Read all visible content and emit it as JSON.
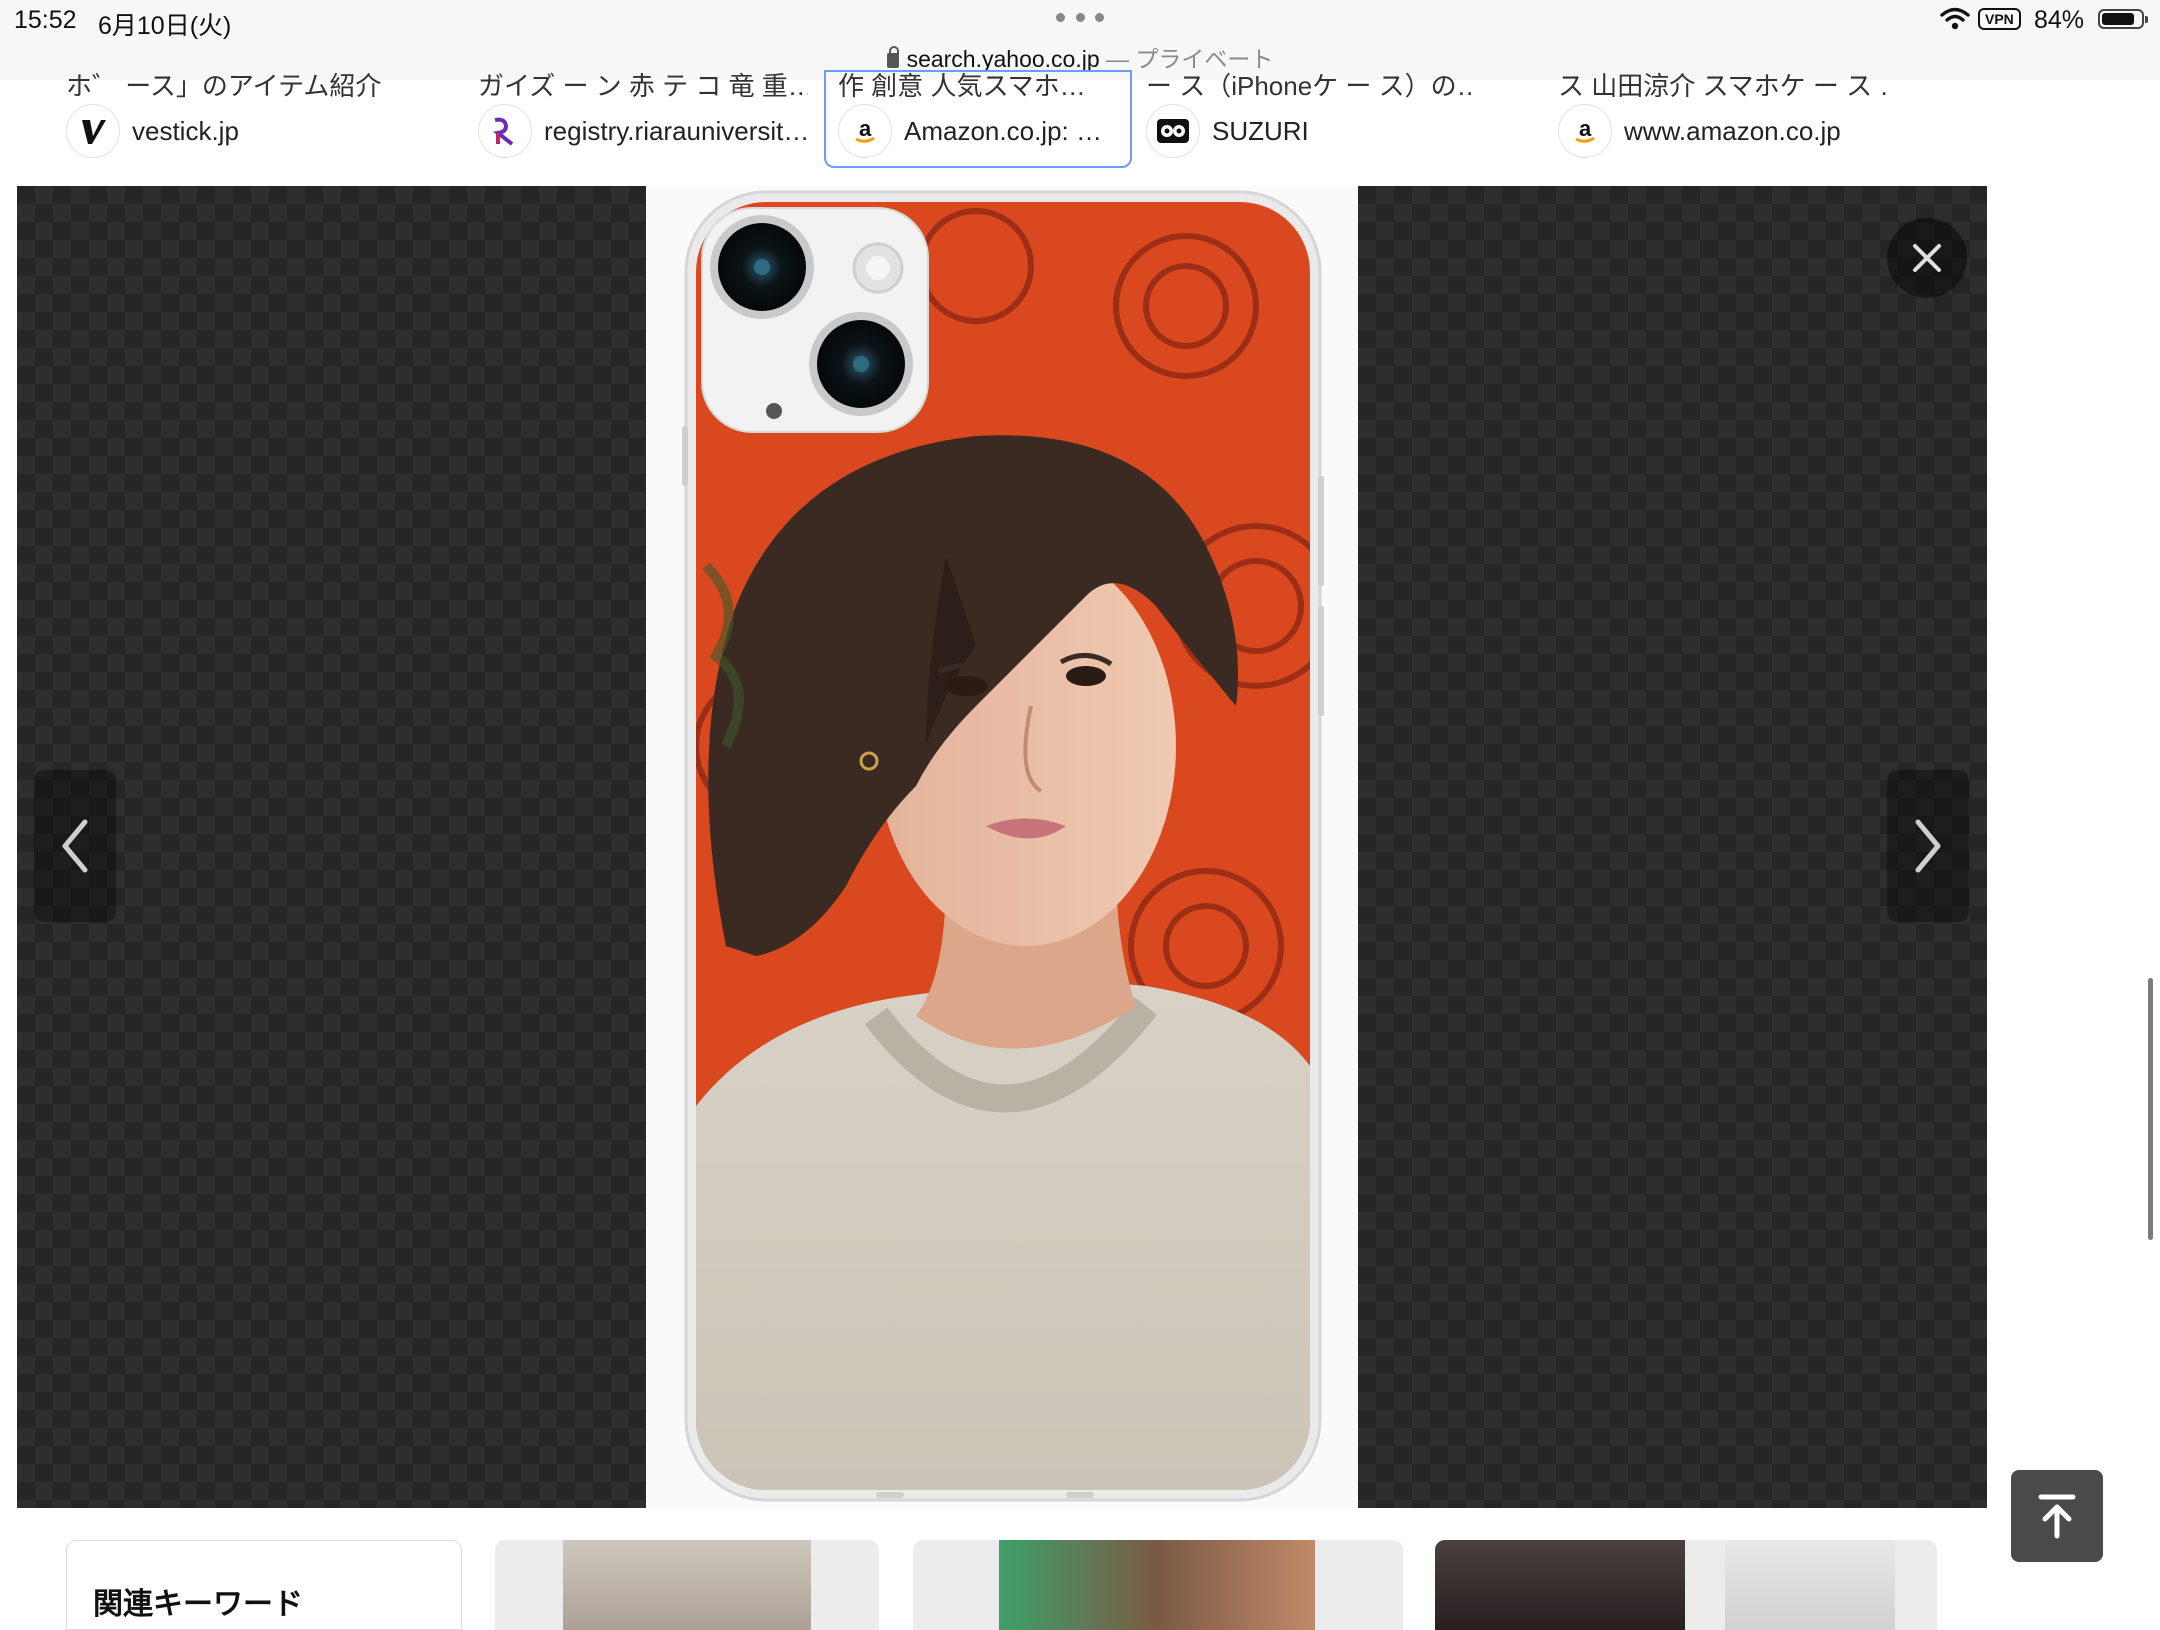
{
  "status_bar": {
    "time": "15:52",
    "date": "6月10日(火)",
    "url": "search.yahoo.co.jp",
    "private_label": "— プライベート",
    "vpn": "VPN",
    "battery": "84%",
    "battery_level": 0.84
  },
  "sources": [
    {
      "title": "ホ゛ ース」のアイテム紹介",
      "name": "vestick.jp",
      "icon": "vestick-favicon"
    },
    {
      "title": "ガイズ ー ン 赤 テ コ 竜 重…",
      "name": "registry.riarauniversit…",
      "icon": "riara-favicon"
    },
    {
      "title": "作 創意 人気スマホ…",
      "name": "Amazon.co.jp: …",
      "icon": "amazon-favicon",
      "active": true
    },
    {
      "title": "ー ス（iPhoneケ ー ス）の…",
      "name": "SUZURI",
      "icon": "suzuri-favicon"
    },
    {
      "title": "ス 山田涼介 スマホケ ー ス …",
      "name": "www.amazon.co.jp",
      "icon": "amazon-favicon"
    }
  ],
  "viewer": {
    "image": "phone-case-photo",
    "prev_icon": "chevron-left-icon",
    "next_icon": "chevron-right-icon",
    "close_icon": "close-icon"
  },
  "bottom": {
    "related_keywords_title": "関連キーワード",
    "scroll_top_icon": "arrow-up-to-top-icon"
  }
}
